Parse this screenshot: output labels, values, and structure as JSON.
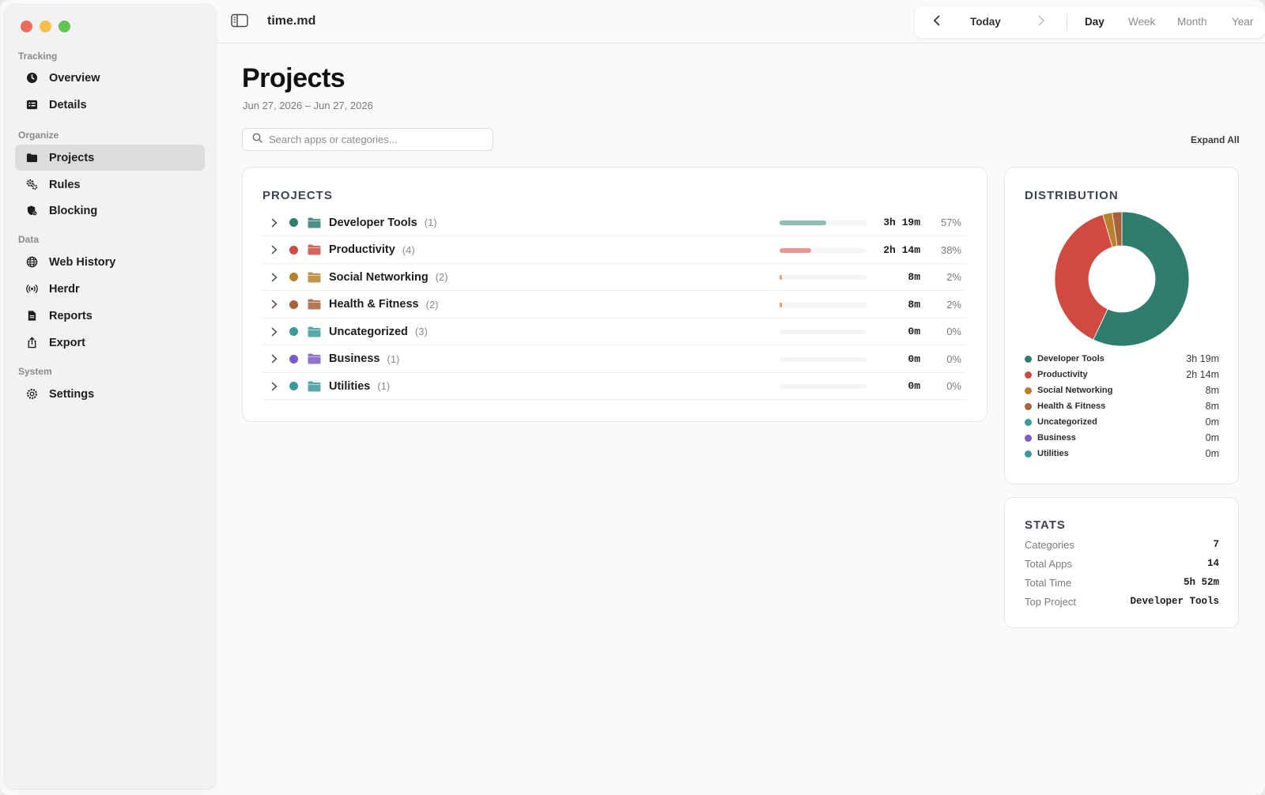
{
  "app": {
    "doc_title": "time.md"
  },
  "traffic_lights": {
    "close": "#ed6a5e",
    "minimize": "#f5bf4f",
    "zoom": "#61c554"
  },
  "sidebar": {
    "sections": [
      {
        "label": "Tracking",
        "items": [
          {
            "label": "Overview",
            "icon": "clock-icon"
          },
          {
            "label": "Details",
            "icon": "list-icon"
          }
        ]
      },
      {
        "label": "Organize",
        "items": [
          {
            "label": "Projects",
            "icon": "folder-icon",
            "active": true
          },
          {
            "label": "Rules",
            "icon": "gears-icon"
          },
          {
            "label": "Blocking",
            "icon": "shield-icon"
          }
        ]
      },
      {
        "label": "Data",
        "items": [
          {
            "label": "Web History",
            "icon": "globe-icon"
          },
          {
            "label": "Herdr",
            "icon": "broadcast-icon"
          },
          {
            "label": "Reports",
            "icon": "document-icon"
          },
          {
            "label": "Export",
            "icon": "share-icon"
          }
        ]
      },
      {
        "label": "System",
        "items": [
          {
            "label": "Settings",
            "icon": "gear-icon"
          }
        ]
      }
    ]
  },
  "period": {
    "today_label": "Today",
    "segments": [
      "Day",
      "Week",
      "Month",
      "Year"
    ],
    "active": "Day"
  },
  "page": {
    "title": "Projects",
    "date_range": "Jun 27, 2026 – Jun 27, 2026",
    "search_placeholder": "Search apps or categories...",
    "expand_all": "Expand All"
  },
  "projects": {
    "title": "PROJECTS",
    "rows": [
      {
        "name": "Developer Tools",
        "count": "(1)",
        "duration": "3h 19m",
        "percent": "57%",
        "fraction": 0.57,
        "color": "#2f7d6d",
        "bar_color": "#8fbdb1"
      },
      {
        "name": "Productivity",
        "count": "(4)",
        "duration": "2h 14m",
        "percent": "38%",
        "fraction": 0.38,
        "color": "#cf4a40",
        "bar_color": "#e79891"
      },
      {
        "name": "Social Networking",
        "count": "(2)",
        "duration": "8m",
        "percent": "2%",
        "fraction": 0.02,
        "color": "#b7822b",
        "bar_color": "#e9a06a"
      },
      {
        "name": "Health & Fitness",
        "count": "(2)",
        "duration": "8m",
        "percent": "2%",
        "fraction": 0.02,
        "color": "#a8623a",
        "bar_color": "#e9a06a"
      },
      {
        "name": "Uncategorized",
        "count": "(3)",
        "duration": "0m",
        "percent": "0%",
        "fraction": 0,
        "color": "#3a9a9a",
        "bar_color": "#8fbdb1"
      },
      {
        "name": "Business",
        "count": "(1)",
        "duration": "0m",
        "percent": "0%",
        "fraction": 0,
        "color": "#7b5cc6",
        "bar_color": "#b9a6e6"
      },
      {
        "name": "Utilities",
        "count": "(1)",
        "duration": "0m",
        "percent": "0%",
        "fraction": 0,
        "color": "#3a9a9a",
        "bar_color": "#8fbdb1"
      }
    ]
  },
  "distribution": {
    "title": "DISTRIBUTION",
    "legend": [
      {
        "name": "Developer Tools",
        "value": "3h 19m",
        "color": "#2f7d6d"
      },
      {
        "name": "Productivity",
        "value": "2h 14m",
        "color": "#cf4a40"
      },
      {
        "name": "Social Networking",
        "value": "8m",
        "color": "#b7822b"
      },
      {
        "name": "Health & Fitness",
        "value": "8m",
        "color": "#a8623a"
      },
      {
        "name": "Uncategorized",
        "value": "0m",
        "color": "#3a9a9a"
      },
      {
        "name": "Business",
        "value": "0m",
        "color": "#7b5cc6"
      },
      {
        "name": "Utilities",
        "value": "0m",
        "color": "#3a9a9a"
      }
    ]
  },
  "chart_data": {
    "type": "pie",
    "categories": [
      "Developer Tools",
      "Productivity",
      "Social Networking",
      "Health & Fitness",
      "Uncategorized",
      "Business",
      "Utilities"
    ],
    "values": [
      199,
      134,
      8,
      8,
      0,
      0,
      0
    ],
    "colors": [
      "#2f7d6d",
      "#cf4a40",
      "#b7822b",
      "#a8623a",
      "#3a9a9a",
      "#7b5cc6",
      "#3a9a9a"
    ],
    "title": "DISTRIBUTION",
    "donut": true
  },
  "stats": {
    "title": "STATS",
    "rows": [
      {
        "label": "Categories",
        "value": "7"
      },
      {
        "label": "Total Apps",
        "value": "14"
      },
      {
        "label": "Total Time",
        "value": "5h 52m"
      },
      {
        "label": "Top Project",
        "value": "Developer Tools"
      }
    ]
  }
}
